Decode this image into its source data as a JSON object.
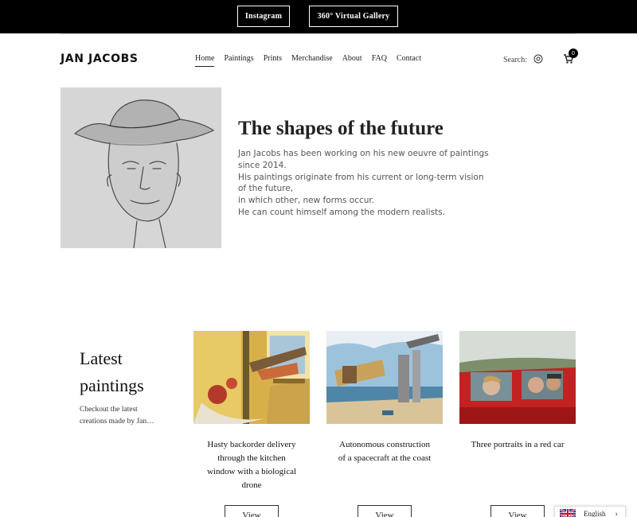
{
  "topbar": {
    "instagram_label": "Instagram",
    "gallery_label": "360° Virtual Gallery"
  },
  "header": {
    "logo": "JAN JACOBS",
    "nav": [
      "Home",
      "Paintings",
      "Prints",
      "Merchandise",
      "About",
      "FAQ",
      "Contact"
    ],
    "active_nav": "Home",
    "search_label": "Search:",
    "cart_count": "0"
  },
  "hero": {
    "title": "The shapes of the future",
    "lines": [
      "Jan Jacobs has been working on his new oeuvre of paintings",
      "since 2014.",
      "His paintings originate from his current or long-term vision",
      "of the future,",
      "in which other, new forms occur.",
      "He can count himself among the modern realists."
    ]
  },
  "latest": {
    "title_line1": "Latest",
    "title_line2": "paintings",
    "subtitle_line1": "Checkout the latest",
    "subtitle_line2": "creations made by Jan…"
  },
  "cards": [
    {
      "title": "Hasty backorder delivery through the kitchen window with a biological drone",
      "button": "View"
    },
    {
      "title": "Autonomous construction of a spacecraft at the coast",
      "button": "View"
    },
    {
      "title": "Three portraits in a red car",
      "button": "View"
    }
  ],
  "language": {
    "label": "English"
  },
  "colors": {
    "topbar": "#000000",
    "text": "#222222",
    "muted": "#555555"
  }
}
